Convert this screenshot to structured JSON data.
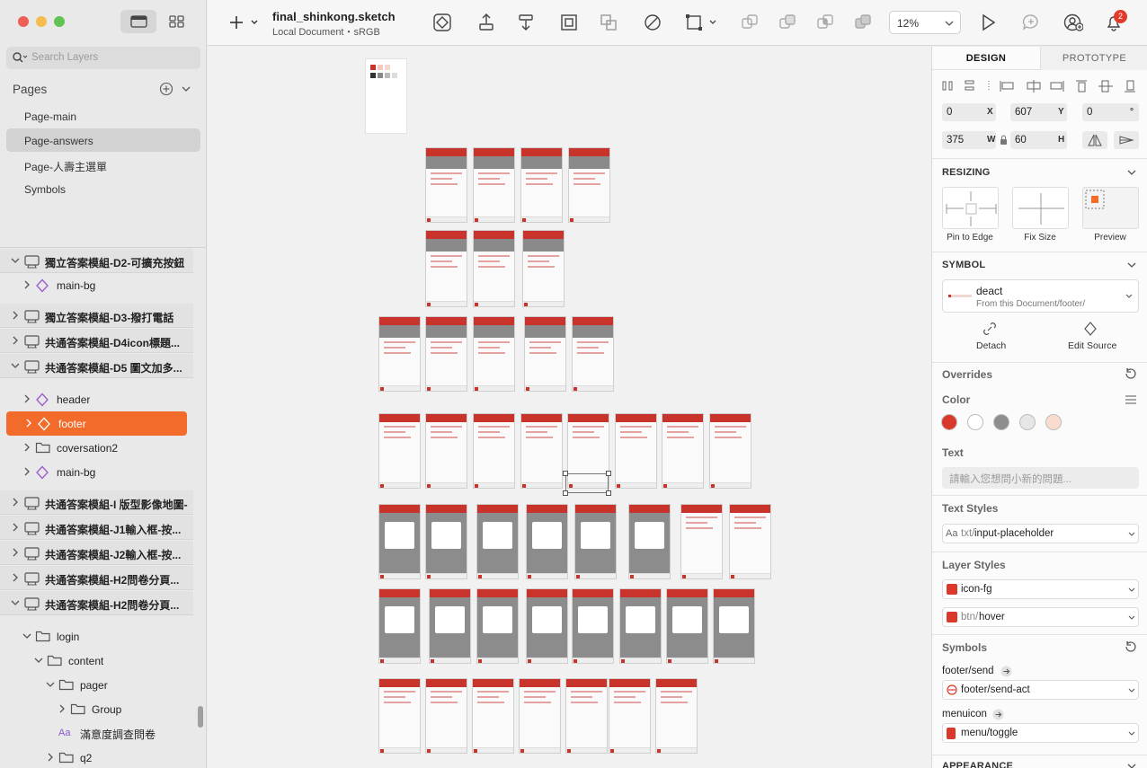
{
  "document": {
    "title": "final_shinkong.sketch",
    "subtitle": "Local Document・sRGB"
  },
  "search": {
    "placeholder": "Search Layers"
  },
  "pages": {
    "title": "Pages",
    "items": [
      {
        "label": "Page-main"
      },
      {
        "label": "Page-answers"
      },
      {
        "label": "Page-人壽主選單"
      },
      {
        "label": "Symbols"
      }
    ]
  },
  "layers": [
    {
      "label": "獨立答案模組-D2-可擴充按鈕",
      "icon": "artboard-icon",
      "indent": 0,
      "expanded": true,
      "group": true
    },
    {
      "label": "main-bg",
      "icon": "symbol-icon",
      "indent": 1,
      "expanded": false
    },
    {
      "label": "獨立答案模組-D3-撥打電話",
      "icon": "artboard-icon",
      "indent": 0,
      "expanded": false,
      "group": true
    },
    {
      "label": "共通答案模組-D4icon標題...",
      "icon": "artboard-icon",
      "indent": 0,
      "expanded": false,
      "group": true
    },
    {
      "label": "共通答案模組-D5 圖文加多...",
      "icon": "artboard-icon",
      "indent": 0,
      "expanded": true,
      "group": true
    },
    {
      "label": "header",
      "icon": "symbol-icon",
      "indent": 1,
      "expanded": false
    },
    {
      "label": "footer",
      "icon": "symbol-icon",
      "indent": 1,
      "expanded": false,
      "selected": true
    },
    {
      "label": "coversation2",
      "icon": "folder-icon",
      "indent": 1,
      "expanded": false
    },
    {
      "label": "main-bg",
      "icon": "symbol-icon",
      "indent": 1,
      "expanded": false
    },
    {
      "label": "共通答案模組-I 版型影像地圖-",
      "icon": "artboard-icon",
      "indent": 0,
      "expanded": false,
      "group": true
    },
    {
      "label": "共通答案模組-J1輸入框-按...",
      "icon": "artboard-icon",
      "indent": 0,
      "expanded": false,
      "group": true
    },
    {
      "label": "共通答案模組-J2輸入框-按...",
      "icon": "artboard-icon",
      "indent": 0,
      "expanded": false,
      "group": true
    },
    {
      "label": "共通答案模組-H2問卷分頁...",
      "icon": "artboard-icon",
      "indent": 0,
      "expanded": false,
      "group": true
    },
    {
      "label": "共通答案模組-H2問卷分頁...",
      "icon": "artboard-icon",
      "indent": 0,
      "expanded": true,
      "group": true
    },
    {
      "label": "login",
      "icon": "folder-icon",
      "indent": 1,
      "expanded": true
    },
    {
      "label": "content",
      "icon": "folder-icon",
      "indent": 2,
      "expanded": true
    },
    {
      "label": "pager",
      "icon": "folder-icon",
      "indent": 3,
      "expanded": true
    },
    {
      "label": "Group",
      "icon": "folder-icon",
      "indent": 4,
      "expanded": false
    },
    {
      "label": "滿意度調查問卷",
      "icon": "text-icon",
      "indent": 3,
      "expanded": null
    },
    {
      "label": "q2",
      "icon": "folder-icon",
      "indent": 3,
      "expanded": false
    }
  ],
  "toolbar": {
    "zoom": "12%",
    "notifications": "2"
  },
  "inspector": {
    "tabs": [
      "DESIGN",
      "PROTOTYPE"
    ],
    "active_tab": "DESIGN",
    "position": {
      "x": "0",
      "x_unit": "X",
      "y": "607",
      "y_unit": "Y",
      "rotation": "0",
      "rotation_unit": "°"
    },
    "size": {
      "w": "375",
      "w_unit": "W",
      "h": "60",
      "h_unit": "H"
    },
    "resizing": {
      "title": "RESIZING",
      "options": [
        "Pin to Edge",
        "Fix Size",
        "Preview"
      ]
    },
    "symbol": {
      "title": "SYMBOL",
      "name": "deact",
      "source": "From this Document/footer/",
      "detach": "Detach",
      "edit_source": "Edit Source"
    },
    "overrides": {
      "title": "Overrides",
      "color_label": "Color",
      "colors": [
        "#d9382a",
        "#ffffff",
        "#8e8e8e",
        "#e6e6e6",
        "#f9dccf"
      ],
      "text_label": "Text",
      "text_placeholder": "請輸入您想問小新的問題...",
      "text_styles_label": "Text Styles",
      "text_style_prefix": "Aa",
      "text_style_dim": "txt/",
      "text_style_value": "input-placeholder",
      "layer_styles_label": "Layer Styles",
      "layer_style_1": "icon-fg",
      "layer_style_2_dim": "btn/",
      "layer_style_2": "hover",
      "symbols_label": "Symbols",
      "sym1_label": "footer/send",
      "sym1_value": "footer/send-act",
      "sym2_label": "menuicon",
      "sym2_value": "menu/toggle"
    },
    "appearance": "APPEARANCE"
  },
  "colors": {
    "accent": "#f26b2a",
    "brand_red": "#c8342c",
    "badge": "#e23a2a"
  }
}
